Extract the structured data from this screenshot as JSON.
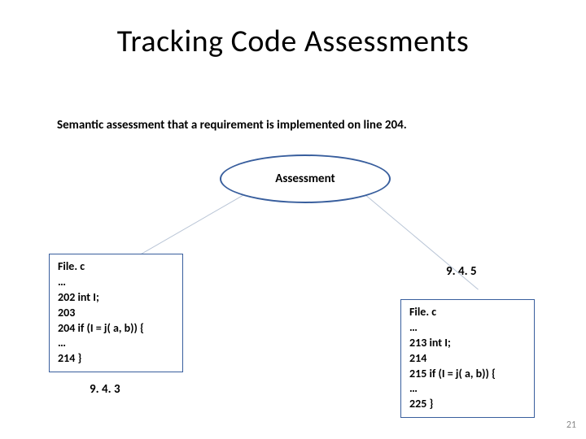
{
  "title": "Tracking Code Assessments",
  "subtitle": "Semantic assessment that a requirement is implemented on line 204.",
  "ellipse_label": "Assessment",
  "codebox1": "File. c\n…\n202 int I;\n203\n204 if (I = j( a, b)) {\n…\n214 }",
  "codebox2": "File. c\n…\n213 int I;\n214\n215 if (I = j( a, b)) {\n…\n225 }",
  "version1": "9. 4. 3",
  "version2": "9. 4. 5",
  "page_number": "21"
}
